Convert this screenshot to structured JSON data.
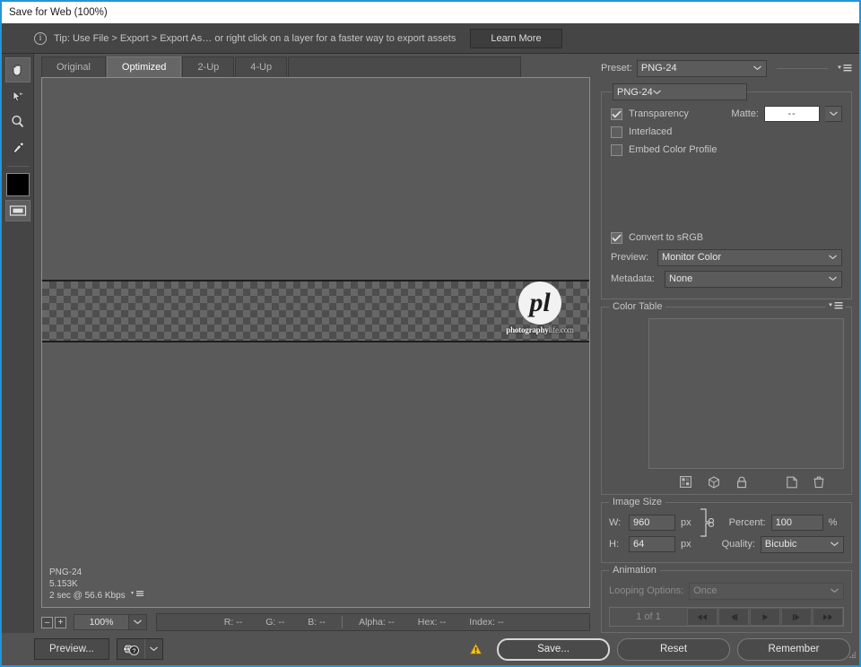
{
  "window": {
    "title": "Save for Web (100%)",
    "accent_color": "#2196d8"
  },
  "tip": {
    "text": "Tip: Use File > Export > Export As…  or right click on a layer for a faster way to export assets",
    "learn_more_label": "Learn More",
    "info_glyph": "i"
  },
  "toolbar": {
    "tools": [
      {
        "name": "hand-tool",
        "active": true
      },
      {
        "name": "slice-select-tool",
        "active": false
      },
      {
        "name": "zoom-tool",
        "active": false
      },
      {
        "name": "eyedropper-tool",
        "active": false
      }
    ],
    "foreground_color": "#000000"
  },
  "tabs": [
    {
      "label": "Original",
      "active": false
    },
    {
      "label": "Optimized",
      "active": true
    },
    {
      "label": "2-Up",
      "active": false
    },
    {
      "label": "4-Up",
      "active": false
    }
  ],
  "preview": {
    "logo_monogram": "pl",
    "logo_text_bold": "photography",
    "logo_text_light": "life.com",
    "file_info": {
      "format": "PNG-24",
      "size": "5.153K",
      "speed": "2 sec @ 56.6 Kbps"
    }
  },
  "statusbar": {
    "zoom_out_label": "–",
    "zoom_in_label": "+",
    "zoom_value": "100%",
    "readouts": [
      {
        "label": "R:",
        "value": "--"
      },
      {
        "label": "G:",
        "value": "--"
      },
      {
        "label": "B:",
        "value": "--"
      },
      {
        "label": "Alpha:",
        "value": "--"
      },
      {
        "label": "Hex:",
        "value": "--"
      },
      {
        "label": "Index:",
        "value": "--"
      }
    ]
  },
  "settings": {
    "preset_label": "Preset:",
    "preset_value": "PNG-24",
    "format_value": "PNG-24",
    "transparency_label": "Transparency",
    "transparency_checked": true,
    "interlaced_label": "Interlaced",
    "interlaced_checked": false,
    "embed_profile_label": "Embed Color Profile",
    "embed_profile_checked": false,
    "matte_label": "Matte:",
    "matte_value": "--",
    "convert_srgb_label": "Convert to sRGB",
    "convert_srgb_checked": true,
    "preview_label": "Preview:",
    "preview_value": "Monitor Color",
    "metadata_label": "Metadata:",
    "metadata_value": "None"
  },
  "color_table": {
    "title": "Color Table",
    "footer_icons": [
      "transparency-icon",
      "web-snap-icon",
      "lock-icon",
      "new-color-icon",
      "delete-color-icon"
    ]
  },
  "image_size": {
    "title": "Image Size",
    "width_label": "W:",
    "width_value": "960",
    "width_unit": "px",
    "height_label": "H:",
    "height_value": "64",
    "height_unit": "px",
    "percent_label": "Percent:",
    "percent_value": "100",
    "percent_unit": "%",
    "quality_label": "Quality:",
    "quality_value": "Bicubic"
  },
  "animation": {
    "title": "Animation",
    "looping_label": "Looping Options:",
    "looping_value": "Once",
    "frame_count": "1 of 1"
  },
  "footer": {
    "preview_button": "Preview...",
    "save_button": "Save...",
    "reset_button": "Reset",
    "remember_button": "Remember",
    "warning_color": "#f2c029"
  }
}
